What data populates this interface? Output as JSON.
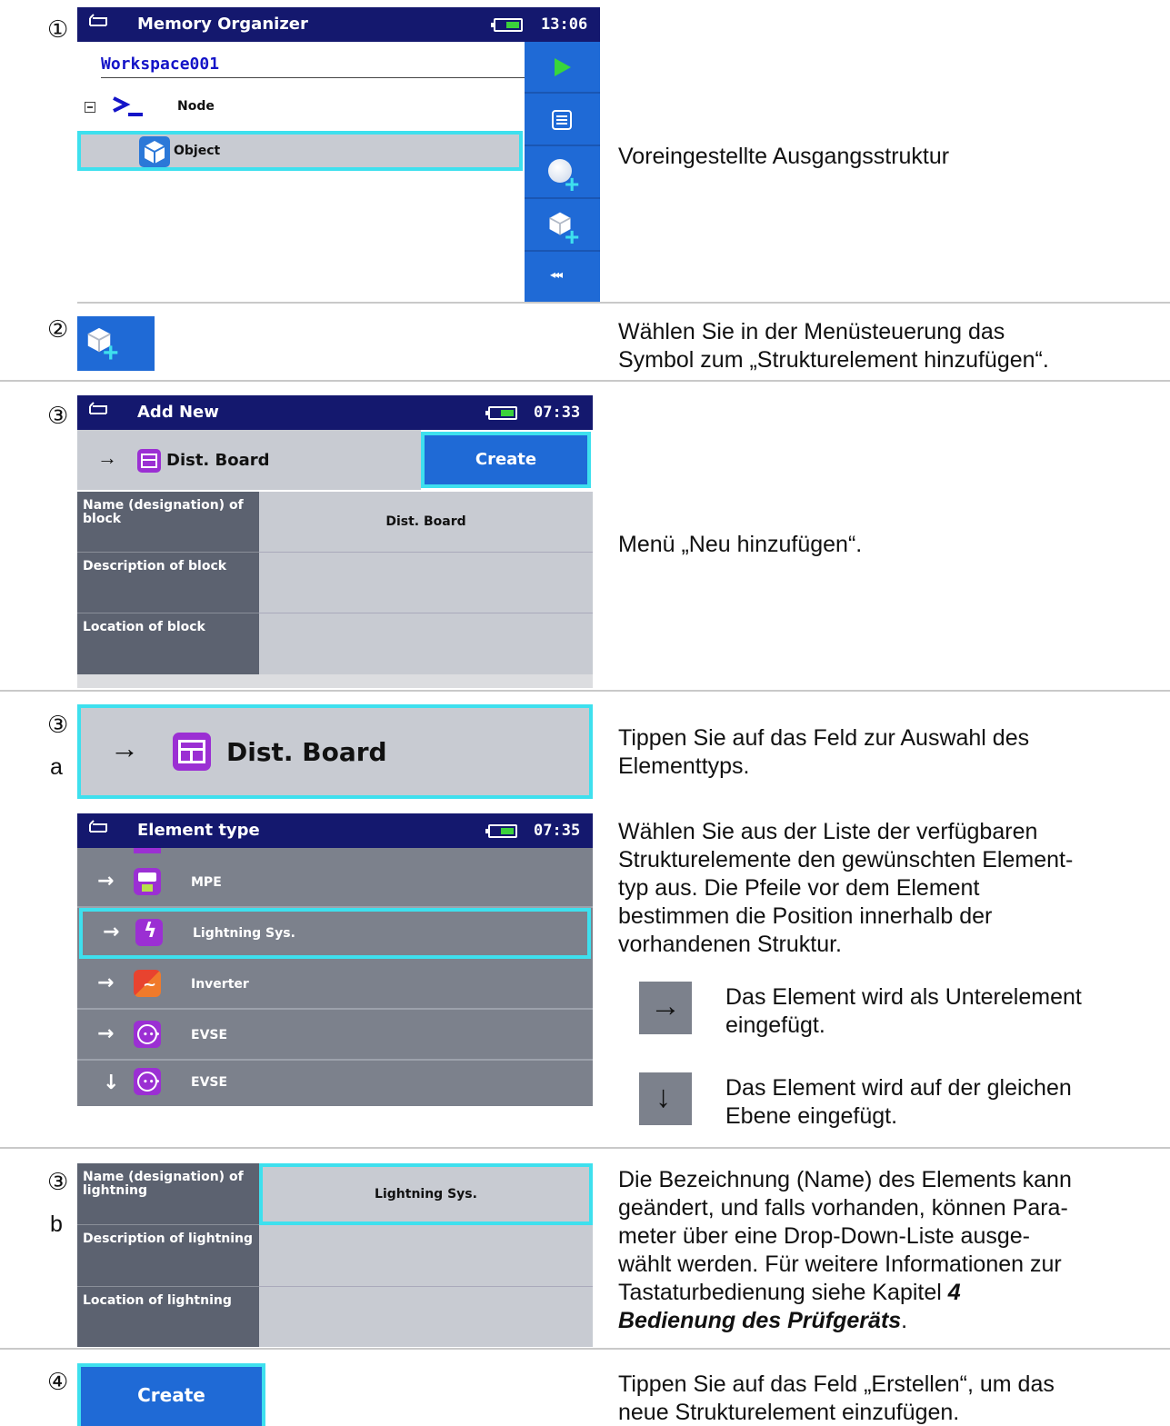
{
  "steps": {
    "s1": "①",
    "s2": "②",
    "s3": "③",
    "s3a": "③",
    "s3a_sub": "a",
    "s3b": "③",
    "s3b_sub": "b",
    "s4": "④"
  },
  "screen1": {
    "title": "Memory Organizer",
    "time": "13:06",
    "workspace": "Workspace001",
    "node_label": "Node",
    "object_label": "Object",
    "more_label": "◂◂◂"
  },
  "desc1": "Voreingestellte Ausgangsstruktur",
  "desc2_line1": "Wählen Sie in der Menüsteuerung das",
  "desc2_line2": "Symbol zum „Strukturelement hinzufügen“.",
  "screen3": {
    "title": "Add New",
    "time": "07:33",
    "element": "Dist. Board",
    "create": "Create",
    "rows": [
      {
        "label": "Name (designation) of block",
        "value": "Dist. Board"
      },
      {
        "label": "Description of block",
        "value": ""
      },
      {
        "label": "Location of block",
        "value": ""
      }
    ]
  },
  "desc3": "Menü „Neu hinzufügen“.",
  "screen3a_zoom": {
    "element": "Dist. Board"
  },
  "desc3a_line1": "Tippen Sie auf das Feld zur Auswahl des",
  "desc3a_line2": "Elementtyps.",
  "screen_type": {
    "title": "Element type",
    "time": "07:35",
    "items": [
      {
        "arrow": "→",
        "label": "MPE",
        "color": "#9b2fd3"
      },
      {
        "arrow": "→",
        "label": "Lightning Sys.",
        "color": "#9b2fd3"
      },
      {
        "arrow": "→",
        "label": "Inverter",
        "color": "#e8432f"
      },
      {
        "arrow": "→",
        "label": "EVSE",
        "color": "#9b2fd3"
      },
      {
        "arrow": "↓",
        "label": "EVSE",
        "color": "#9b2fd3"
      }
    ]
  },
  "desc_type_lines": [
    "Wählen Sie aus der Liste der verfügbaren",
    "Strukturelemente den gewünschten Element-",
    "typ aus. Die Pfeile vor dem Element",
    "bestimmen die Position innerhalb der",
    "vorhandenen Struktur."
  ],
  "legend": [
    {
      "arrow": "→",
      "line1": "Das Element wird als Unterelement",
      "line2": "eingefügt."
    },
    {
      "arrow": "↓",
      "line1": "Das Element wird auf der gleichen",
      "line2": "Ebene eingefügt."
    }
  ],
  "screen3b": {
    "rows": [
      {
        "label": "Name (designation) of lightning",
        "value": "Lightning Sys."
      },
      {
        "label": "Description of lightning",
        "value": ""
      },
      {
        "label": "Location of lightning",
        "value": ""
      }
    ]
  },
  "desc3b_lines": [
    "Die Bezeichnung (Name) des Elements kann",
    "geändert, und falls vorhanden, können Para-",
    "meter über eine Drop-Down-Liste ausge-",
    "wählt werden. Für weitere Informationen zur",
    "Tastaturbedienung siehe Kapitel "
  ],
  "desc3b_bold_num": "4",
  "desc3b_bold_tail": "Bedienung des Prüfgeräts",
  "desc3b_end": ".",
  "screen4": {
    "create": "Create"
  },
  "desc4_line1": "Tippen Sie auf das Feld „Erstellen“, um das",
  "desc4_line2": "neue Strukturelement einzufügen."
}
